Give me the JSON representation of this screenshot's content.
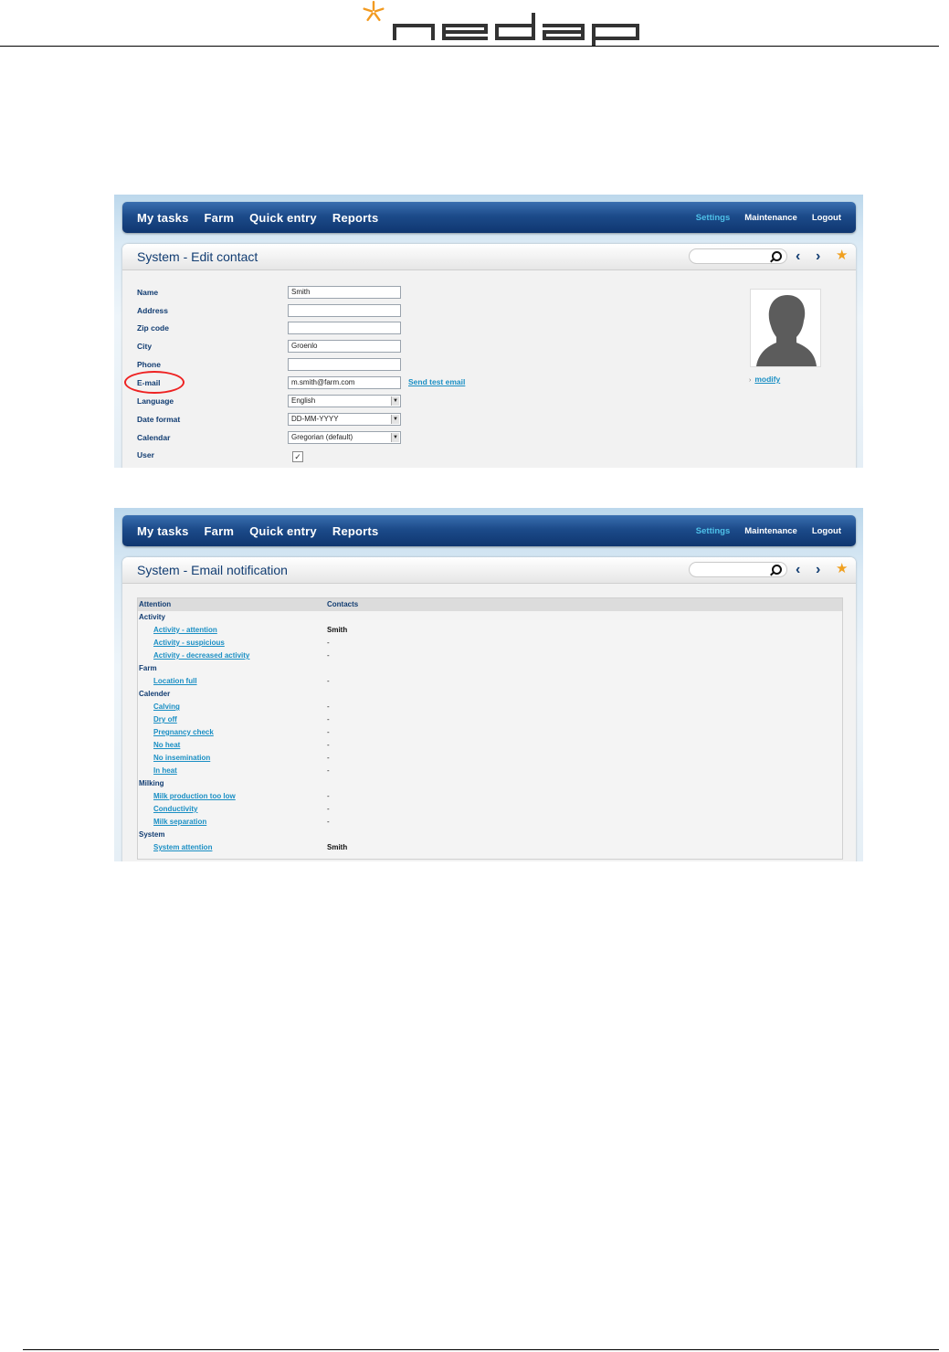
{
  "brand": {
    "logo_name": "nedap"
  },
  "screens": {
    "edit_contact": {
      "nav": {
        "items": [
          "My tasks",
          "Farm",
          "Quick entry",
          "Reports"
        ],
        "right": [
          "Settings",
          "Maintenance",
          "Logout"
        ]
      },
      "title": "System - Edit contact",
      "fields": {
        "name": {
          "label": "Name",
          "value": "Smith"
        },
        "address": {
          "label": "Address",
          "value": ""
        },
        "zip": {
          "label": "Zip code",
          "value": ""
        },
        "city": {
          "label": "City",
          "value": "Groenlo"
        },
        "phone": {
          "label": "Phone",
          "value": ""
        },
        "email": {
          "label": "E-mail",
          "value": "m.smith@farm.com"
        },
        "language": {
          "label": "Language",
          "value": "English"
        },
        "date_format": {
          "label": "Date format",
          "value": "DD-MM-YYYY"
        },
        "calendar": {
          "label": "Calendar",
          "value": "Gregorian (default)"
        },
        "user": {
          "label": "User",
          "checked": true
        }
      },
      "send_test_email": "Send test email",
      "modify": "modify",
      "annotation_color": "#e22222"
    },
    "email_notification": {
      "nav": {
        "items": [
          "My tasks",
          "Farm",
          "Quick entry",
          "Reports"
        ],
        "right": [
          "Settings",
          "Maintenance",
          "Logout"
        ]
      },
      "title": "System - Email notification",
      "columns": {
        "attention": "Attention",
        "contacts": "Contacts"
      },
      "groups": {
        "activity": {
          "label": "Activity",
          "items": [
            {
              "name": "Activity - attention",
              "contact": "Smith"
            },
            {
              "name": "Activity - suspicious",
              "contact": "-"
            },
            {
              "name": "Activity - decreased activity",
              "contact": "-"
            }
          ]
        },
        "farm": {
          "label": "Farm",
          "items": [
            {
              "name": "Location full",
              "contact": "-"
            }
          ]
        },
        "calender": {
          "label": "Calender",
          "items": [
            {
              "name": "Calving",
              "contact": "-"
            },
            {
              "name": "Dry off",
              "contact": "-"
            },
            {
              "name": "Pregnancy check",
              "contact": "-"
            },
            {
              "name": "No heat",
              "contact": "-"
            },
            {
              "name": "No insemination",
              "contact": "-"
            },
            {
              "name": "In heat",
              "contact": "-"
            }
          ]
        },
        "milking": {
          "label": "Milking",
          "items": [
            {
              "name": "Milk production too low",
              "contact": "-"
            },
            {
              "name": "Conductivity",
              "contact": "-"
            },
            {
              "name": "Milk separation",
              "contact": "-"
            }
          ]
        },
        "system": {
          "label": "System",
          "items": [
            {
              "name": "System attention",
              "contact": "Smith"
            }
          ]
        }
      }
    }
  },
  "colors": {
    "nav_bg": "#1c4b8a",
    "accent": "#1a8fc4",
    "active_nav": "#4fc1e9",
    "title_text": "#123d72",
    "logo_orange": "#f29a20"
  }
}
